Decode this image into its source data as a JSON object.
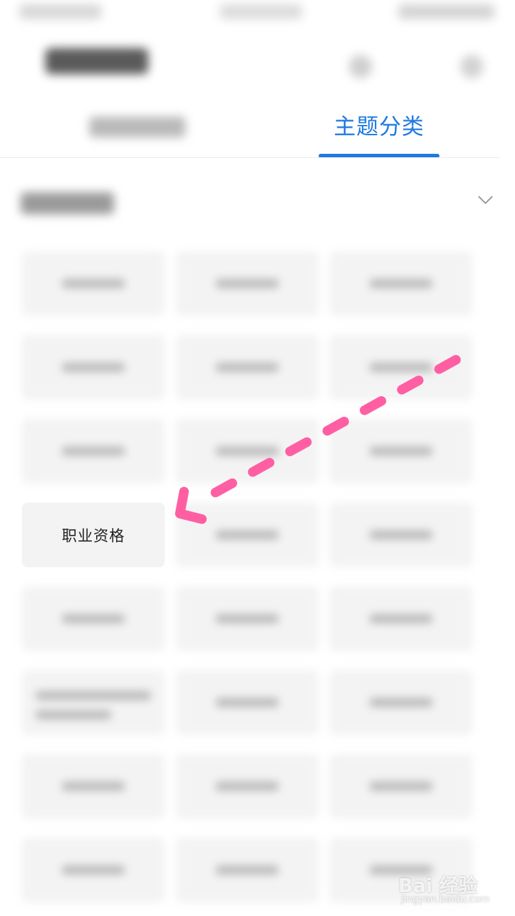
{
  "tabs": {
    "active_label": "主题分类",
    "active_color": "#1f7ae0"
  },
  "section": {
    "expand_icon": "chevron-down-icon"
  },
  "grid": {
    "highlighted_item": {
      "label": "职业资格"
    }
  },
  "annotation": {
    "arrow_color": "#ff5fa2",
    "arrow_style": "dashed"
  },
  "watermark": {
    "main": "Bai 经验",
    "sub": "jingyan.baidu.com"
  }
}
